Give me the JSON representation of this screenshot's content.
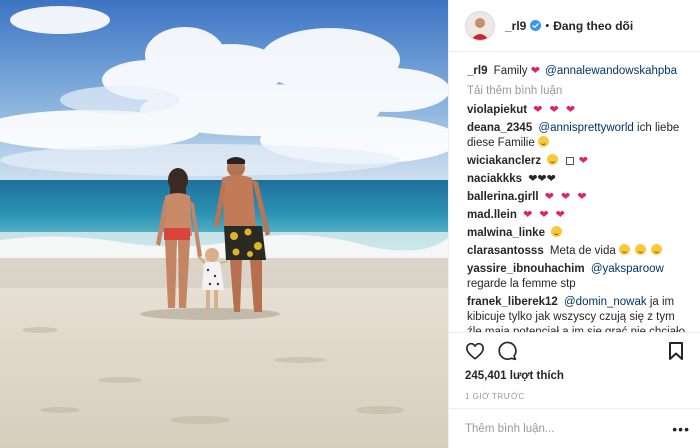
{
  "header": {
    "username": "_rl9",
    "separator": "•",
    "follow_status": "Đang theo dõi"
  },
  "caption": {
    "username": "_rl9",
    "text": "Family",
    "mention": "@annalewandowskahpba"
  },
  "load_more": "Tải thêm bình luận",
  "comments": [
    {
      "user": "violapiekut",
      "text": "",
      "mention": "",
      "hearts": "❤ ❤ ❤"
    },
    {
      "user": "deana_2345",
      "mention": "@annisprettyworld",
      "text": "ich liebe diese Familie",
      "hearts": ""
    },
    {
      "user": "wiciakanclerz",
      "text": "",
      "mention": "",
      "hearts": "❤"
    },
    {
      "user": "naciakkks",
      "text": "",
      "mention": "",
      "hearts": "❤❤❤"
    },
    {
      "user": "ballerina.girll",
      "text": "",
      "mention": "",
      "hearts": "❤ ❤ ❤"
    },
    {
      "user": "mad.llein",
      "text": "",
      "mention": "",
      "hearts": "❤ ❤ ❤"
    },
    {
      "user": "malwina_linke",
      "text": "",
      "mention": "",
      "hearts": ""
    },
    {
      "user": "clarasantosss",
      "text": "Meta de vida",
      "mention": "",
      "hearts": ""
    },
    {
      "user": "yassire_ibnouhachim",
      "mention": "@yaksparoow",
      "text": "regarde la femme stp",
      "hearts": ""
    },
    {
      "user": "franek_liberek12",
      "mention": "@domin_nowak",
      "text": "ja im kibicuje tylko jak wszyscy czują się z tym źle mają potencjał a im się grać nie chciało to co pokazali było żenada to nie był",
      "hearts": ""
    }
  ],
  "likes": "245,401 lượt thích",
  "timestamp": "1 GIỜ TRƯỚC",
  "add_comment": {
    "placeholder": "Thêm bình luận..."
  },
  "icons": {
    "like": "heart-outline-icon",
    "comment": "comment-bubble-icon",
    "save": "bookmark-icon",
    "verified": "verified-badge-icon",
    "more": "more-options-icon"
  },
  "colors": {
    "mention": "#003569",
    "heart": "#e0245e",
    "verified": "#3897f0",
    "muted": "#999999"
  }
}
